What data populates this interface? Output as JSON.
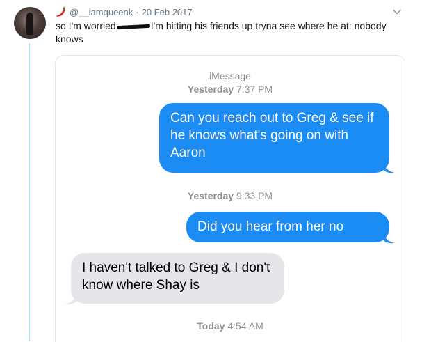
{
  "tweet": {
    "handle": "@__iamqueenk",
    "separator": "·",
    "date": "20 Feb 2017",
    "text_before": "so I'm worried",
    "text_after": "I'm hitting his friends up tryna see where he at: nobody knows"
  },
  "icons": {
    "avatar": "user-avatar",
    "emoji": "chili-pepper-icon",
    "menu": "chevron-down-icon"
  },
  "imessage": {
    "service": "iMessage",
    "timestamps": [
      {
        "day": "Yesterday",
        "time": "7:37 PM"
      },
      {
        "day": "Yesterday",
        "time": "9:33 PM"
      },
      {
        "day": "Today",
        "time": "4:54 AM"
      }
    ],
    "messages": [
      {
        "from": "me",
        "text": "Can you reach out to Greg & see if he knows what's going on with Aaron"
      },
      {
        "from": "me",
        "text": "Did you hear from her no"
      },
      {
        "from": "them",
        "text": "I haven't talked to Greg & I don't know where Shay is"
      }
    ]
  },
  "colors": {
    "sent_bubble": "#1b8cf4",
    "received_bubble": "#e5e5ea",
    "meta_gray": "#8e8e93",
    "thread_line": "#b8e0f5"
  }
}
